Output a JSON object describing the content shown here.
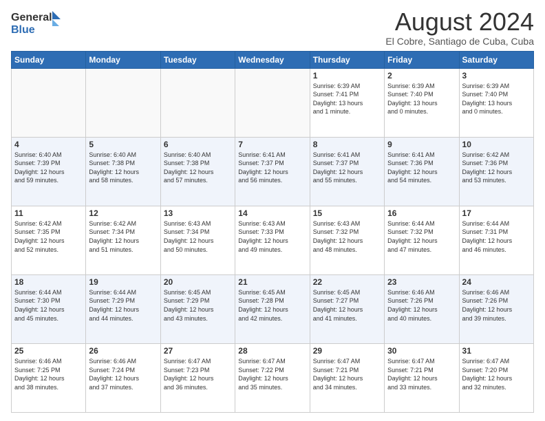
{
  "header": {
    "logo_line1": "General",
    "logo_line2": "Blue",
    "month": "August 2024",
    "location": "El Cobre, Santiago de Cuba, Cuba"
  },
  "days_of_week": [
    "Sunday",
    "Monday",
    "Tuesday",
    "Wednesday",
    "Thursday",
    "Friday",
    "Saturday"
  ],
  "weeks": [
    [
      {
        "day": "",
        "info": ""
      },
      {
        "day": "",
        "info": ""
      },
      {
        "day": "",
        "info": ""
      },
      {
        "day": "",
        "info": ""
      },
      {
        "day": "1",
        "info": "Sunrise: 6:39 AM\nSunset: 7:41 PM\nDaylight: 13 hours\nand 1 minute."
      },
      {
        "day": "2",
        "info": "Sunrise: 6:39 AM\nSunset: 7:40 PM\nDaylight: 13 hours\nand 0 minutes."
      },
      {
        "day": "3",
        "info": "Sunrise: 6:39 AM\nSunset: 7:40 PM\nDaylight: 13 hours\nand 0 minutes."
      }
    ],
    [
      {
        "day": "4",
        "info": "Sunrise: 6:40 AM\nSunset: 7:39 PM\nDaylight: 12 hours\nand 59 minutes."
      },
      {
        "day": "5",
        "info": "Sunrise: 6:40 AM\nSunset: 7:38 PM\nDaylight: 12 hours\nand 58 minutes."
      },
      {
        "day": "6",
        "info": "Sunrise: 6:40 AM\nSunset: 7:38 PM\nDaylight: 12 hours\nand 57 minutes."
      },
      {
        "day": "7",
        "info": "Sunrise: 6:41 AM\nSunset: 7:37 PM\nDaylight: 12 hours\nand 56 minutes."
      },
      {
        "day": "8",
        "info": "Sunrise: 6:41 AM\nSunset: 7:37 PM\nDaylight: 12 hours\nand 55 minutes."
      },
      {
        "day": "9",
        "info": "Sunrise: 6:41 AM\nSunset: 7:36 PM\nDaylight: 12 hours\nand 54 minutes."
      },
      {
        "day": "10",
        "info": "Sunrise: 6:42 AM\nSunset: 7:36 PM\nDaylight: 12 hours\nand 53 minutes."
      }
    ],
    [
      {
        "day": "11",
        "info": "Sunrise: 6:42 AM\nSunset: 7:35 PM\nDaylight: 12 hours\nand 52 minutes."
      },
      {
        "day": "12",
        "info": "Sunrise: 6:42 AM\nSunset: 7:34 PM\nDaylight: 12 hours\nand 51 minutes."
      },
      {
        "day": "13",
        "info": "Sunrise: 6:43 AM\nSunset: 7:34 PM\nDaylight: 12 hours\nand 50 minutes."
      },
      {
        "day": "14",
        "info": "Sunrise: 6:43 AM\nSunset: 7:33 PM\nDaylight: 12 hours\nand 49 minutes."
      },
      {
        "day": "15",
        "info": "Sunrise: 6:43 AM\nSunset: 7:32 PM\nDaylight: 12 hours\nand 48 minutes."
      },
      {
        "day": "16",
        "info": "Sunrise: 6:44 AM\nSunset: 7:32 PM\nDaylight: 12 hours\nand 47 minutes."
      },
      {
        "day": "17",
        "info": "Sunrise: 6:44 AM\nSunset: 7:31 PM\nDaylight: 12 hours\nand 46 minutes."
      }
    ],
    [
      {
        "day": "18",
        "info": "Sunrise: 6:44 AM\nSunset: 7:30 PM\nDaylight: 12 hours\nand 45 minutes."
      },
      {
        "day": "19",
        "info": "Sunrise: 6:44 AM\nSunset: 7:29 PM\nDaylight: 12 hours\nand 44 minutes."
      },
      {
        "day": "20",
        "info": "Sunrise: 6:45 AM\nSunset: 7:29 PM\nDaylight: 12 hours\nand 43 minutes."
      },
      {
        "day": "21",
        "info": "Sunrise: 6:45 AM\nSunset: 7:28 PM\nDaylight: 12 hours\nand 42 minutes."
      },
      {
        "day": "22",
        "info": "Sunrise: 6:45 AM\nSunset: 7:27 PM\nDaylight: 12 hours\nand 41 minutes."
      },
      {
        "day": "23",
        "info": "Sunrise: 6:46 AM\nSunset: 7:26 PM\nDaylight: 12 hours\nand 40 minutes."
      },
      {
        "day": "24",
        "info": "Sunrise: 6:46 AM\nSunset: 7:26 PM\nDaylight: 12 hours\nand 39 minutes."
      }
    ],
    [
      {
        "day": "25",
        "info": "Sunrise: 6:46 AM\nSunset: 7:25 PM\nDaylight: 12 hours\nand 38 minutes."
      },
      {
        "day": "26",
        "info": "Sunrise: 6:46 AM\nSunset: 7:24 PM\nDaylight: 12 hours\nand 37 minutes."
      },
      {
        "day": "27",
        "info": "Sunrise: 6:47 AM\nSunset: 7:23 PM\nDaylight: 12 hours\nand 36 minutes."
      },
      {
        "day": "28",
        "info": "Sunrise: 6:47 AM\nSunset: 7:22 PM\nDaylight: 12 hours\nand 35 minutes."
      },
      {
        "day": "29",
        "info": "Sunrise: 6:47 AM\nSunset: 7:21 PM\nDaylight: 12 hours\nand 34 minutes."
      },
      {
        "day": "30",
        "info": "Sunrise: 6:47 AM\nSunset: 7:21 PM\nDaylight: 12 hours\nand 33 minutes."
      },
      {
        "day": "31",
        "info": "Sunrise: 6:47 AM\nSunset: 7:20 PM\nDaylight: 12 hours\nand 32 minutes."
      }
    ]
  ]
}
